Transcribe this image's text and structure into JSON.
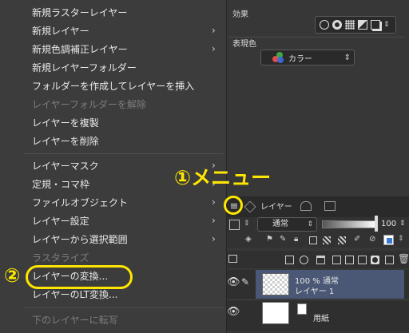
{
  "properties": {
    "effect_label": "効果",
    "color_label": "表現色",
    "color_value": "カラー"
  },
  "layer_panel": {
    "tab_layer": "レイヤー",
    "blend_mode": "通常",
    "opacity": "100",
    "layers": [
      {
        "line1": "100 % 通常",
        "line2": "レイヤー 1",
        "selected": true
      },
      {
        "line1": "",
        "line2": "用紙",
        "selected": false
      }
    ]
  },
  "menu": {
    "items": [
      {
        "label": "新規ラスターレイヤー",
        "submenu": false,
        "disabled": false
      },
      {
        "label": "新規レイヤー",
        "submenu": true,
        "disabled": false
      },
      {
        "label": "新規色調補正レイヤー",
        "submenu": true,
        "disabled": false
      },
      {
        "label": "新規レイヤーフォルダー",
        "submenu": false,
        "disabled": false
      },
      {
        "label": "フォルダーを作成してレイヤーを挿入",
        "submenu": false,
        "disabled": false
      },
      {
        "label": "レイヤーフォルダーを解除",
        "submenu": false,
        "disabled": true
      },
      {
        "label": "レイヤーを複製",
        "submenu": false,
        "disabled": false
      },
      {
        "label": "レイヤーを削除",
        "submenu": false,
        "disabled": false
      },
      {
        "label": "レイヤーマスク",
        "submenu": true,
        "disabled": false
      },
      {
        "label": "定規・コマ枠",
        "submenu": true,
        "disabled": false
      },
      {
        "label": "ファイルオブジェクト",
        "submenu": true,
        "disabled": false
      },
      {
        "label": "レイヤー設定",
        "submenu": true,
        "disabled": false
      },
      {
        "label": "レイヤーから選択範囲",
        "submenu": true,
        "disabled": false
      },
      {
        "label": "ラスタライズ",
        "submenu": false,
        "disabled": true
      },
      {
        "label": "レイヤーの変換...",
        "submenu": false,
        "disabled": false
      },
      {
        "label": "レイヤーのLT変換...",
        "submenu": false,
        "disabled": false
      },
      {
        "label": "下のレイヤーに転写",
        "submenu": false,
        "disabled": true
      }
    ]
  },
  "annotations": {
    "menu_label": "①メニュー",
    "step2_label": "②"
  },
  "colors": {
    "accent": "#ffe600",
    "selected_layer": "#4a5875"
  }
}
